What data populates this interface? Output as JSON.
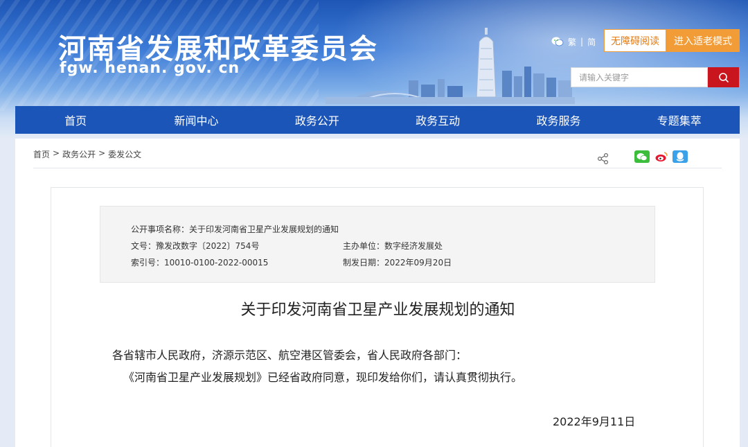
{
  "header": {
    "site_title": "河南省发展和改革委员会",
    "site_domain": "fgw. henan. gov. cn",
    "lang_traditional": "繁",
    "lang_sep": "|",
    "lang_simplified": "简",
    "accessibility_label": "无障碍阅读",
    "elder_mode_label": "进入适老模式",
    "search_placeholder": "请输入关键字",
    "search_icon": "search-icon",
    "wechat_icon": "wechat-icon"
  },
  "nav": {
    "items": [
      "首页",
      "新闻中心",
      "政务公开",
      "政务互动",
      "政务服务",
      "专题集萃"
    ]
  },
  "breadcrumb": {
    "items": [
      "首页",
      ">",
      "政务公开",
      ">",
      "委发公文"
    ]
  },
  "share": {
    "icons": [
      "share-icon",
      "wechat-icon",
      "weibo-icon",
      "qq-icon"
    ]
  },
  "meta": {
    "item_name": "公开事项名称：关于印发河南省卫星产业发展规划的通知",
    "doc_no": "文号：豫发改数字〔2022〕754号",
    "host_unit": "主办单位：数字经济发展处",
    "index_no": "索引号：10010-0100-2022-00015",
    "issue_date": "制发日期：2022年09月20日"
  },
  "document": {
    "title": "关于印发河南省卫星产业发展规划的通知",
    "salutation": "各省辖市人民政府，济源示范区、航空港区管委会，省人民政府各部门：",
    "body": "《河南省卫星产业发展规划》已经省政府同意，现印发给你们，请认真贯彻执行。",
    "date": "2022年9月11日"
  },
  "colors": {
    "nav_bg": "#1c55b8",
    "search_button": "#c8151e",
    "elder_button": "#f29c38",
    "accessibility_text": "#e47a10"
  }
}
